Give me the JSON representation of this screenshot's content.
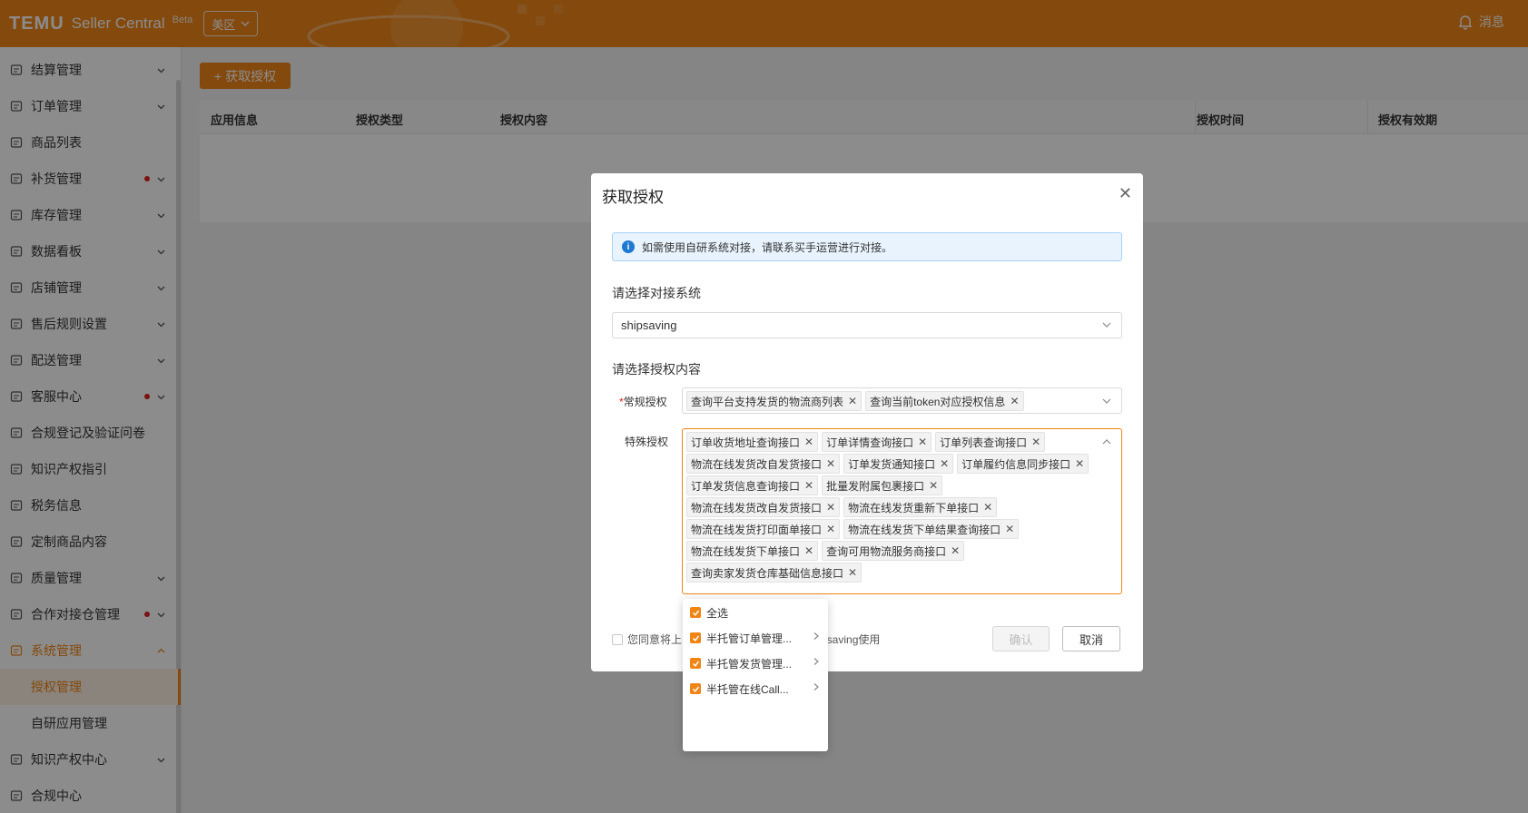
{
  "topbar": {
    "brand": "TEMU",
    "brand_sub": "Seller Central",
    "beta": "Beta",
    "region": "美区",
    "message": "消息"
  },
  "sidebar": {
    "items": [
      {
        "label": "结算管理",
        "icon": "wallet-icon",
        "chevron": true
      },
      {
        "label": "订单管理",
        "icon": "cart-icon",
        "chevron": true
      },
      {
        "label": "商品列表",
        "icon": "list-icon",
        "chevron": false
      },
      {
        "label": "补货管理",
        "icon": "restock-icon",
        "chevron": true,
        "dot": true
      },
      {
        "label": "库存管理",
        "icon": "warehouse-icon",
        "chevron": true
      },
      {
        "label": "数据看板",
        "icon": "dashboard-icon",
        "chevron": true
      },
      {
        "label": "店铺管理",
        "icon": "store-icon",
        "chevron": true
      },
      {
        "label": "售后规则设置",
        "icon": "aftersale-icon",
        "chevron": true
      },
      {
        "label": "配送管理",
        "icon": "truck-icon",
        "chevron": true
      },
      {
        "label": "客服中心",
        "icon": "service-icon",
        "chevron": true,
        "dot": true
      },
      {
        "label": "合规登记及验证问卷",
        "icon": "compliance-icon",
        "chevron": false
      },
      {
        "label": "知识产权指引",
        "icon": "ip-guide-icon",
        "chevron": false
      },
      {
        "label": "税务信息",
        "icon": "tax-icon",
        "chevron": false
      },
      {
        "label": "定制商品内容",
        "icon": "custom-icon",
        "chevron": false
      },
      {
        "label": "质量管理",
        "icon": "quality-icon",
        "chevron": true
      },
      {
        "label": "合作对接仓管理",
        "icon": "partner-icon",
        "chevron": true,
        "dot": true
      },
      {
        "label": "系统管理",
        "icon": "system-icon",
        "chevron": true,
        "active": true
      }
    ],
    "sub_items": [
      {
        "label": "授权管理",
        "selected": true
      },
      {
        "label": "自研应用管理",
        "selected": false
      }
    ],
    "bottom_items": [
      {
        "label": "知识产权中心",
        "icon": "copyright-icon",
        "chevron": true
      },
      {
        "label": "合规中心",
        "icon": "compliance-center-icon",
        "chevron": false
      }
    ]
  },
  "main": {
    "get_auth_button": "获取授权",
    "columns": [
      "应用信息",
      "授权类型",
      "授权内容",
      "授权时间",
      "授权有效期"
    ]
  },
  "modal": {
    "title": "获取授权",
    "info": "如需使用自研系统对接，请联系买手运营进行对接。",
    "system_label": "请选择对接系统",
    "system_value": "shipsaving",
    "content_label": "请选择授权内容",
    "normal_label": "常规授权",
    "normal_tags": [
      "查询平台支持发货的物流商列表",
      "查询当前token对应授权信息"
    ],
    "special_label": "特殊授权",
    "special_tags": [
      "订单收货地址查询接口",
      "订单详情查询接口",
      "订单列表查询接口",
      "物流在线发货改自发货接口",
      "订单发货通知接口",
      "订单履约信息同步接口",
      "订单发货信息查询接口",
      "批量发附属包裹接口",
      "物流在线发货改自发货接口",
      "物流在线发货重新下单接口",
      "物流在线发货打印面单接口",
      "物流在线发货下单结果查询接口",
      "物流在线发货下单接口",
      "查询可用物流服务商接口",
      "查询卖家发货仓库基础信息接口"
    ],
    "agree_prefix": "您同意将上",
    "agree_suffix": "psaving使用",
    "confirm": "确认",
    "cancel": "取消"
  },
  "dropdown": {
    "items": [
      "全选",
      "半托管订单管理...",
      "半托管发货管理...",
      "半托管在线Call..."
    ]
  },
  "colors": {
    "brand": "#f08516",
    "info_blue": "#1f78d1",
    "dot_red": "#e02020"
  }
}
